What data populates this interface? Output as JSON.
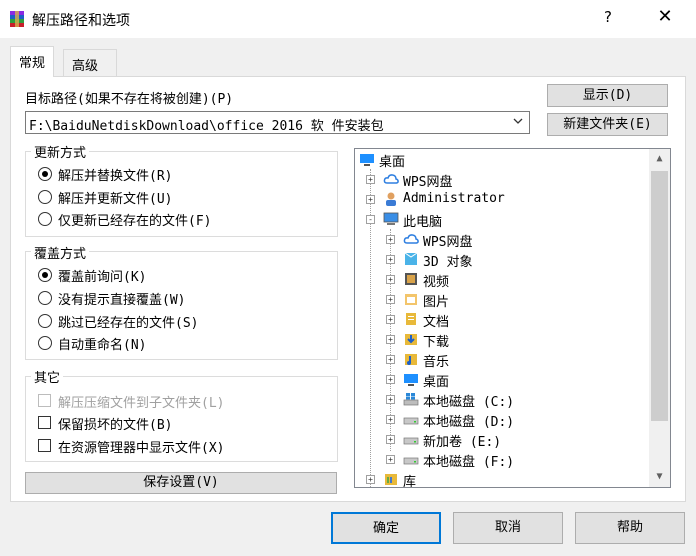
{
  "window": {
    "title": "解压路径和选项",
    "help": "?",
    "close": "✕"
  },
  "tabs": [
    {
      "label": "常规"
    },
    {
      "label": "高级"
    }
  ],
  "dest": {
    "label": "目标路径(如果不存在将被创建)(P)",
    "value": "F:\\BaiduNetdiskDownload\\office 2016 软 件安装包",
    "show_button": "显示(D)",
    "new_folder_button": "新建文件夹(E)"
  },
  "update_mode": {
    "title": "更新方式",
    "options": [
      "解压并替换文件(R)",
      "解压并更新文件(U)",
      "仅更新已经存在的文件(F)"
    ],
    "selected": 0
  },
  "overwrite_mode": {
    "title": "覆盖方式",
    "options": [
      "覆盖前询问(K)",
      "没有提示直接覆盖(W)",
      "跳过已经存在的文件(S)",
      "自动重命名(N)"
    ],
    "selected": 0
  },
  "misc": {
    "title": "其它",
    "options": [
      {
        "label": "解压压缩文件到子文件夹(L)",
        "checked": false,
        "disabled": true
      },
      {
        "label": "保留损坏的文件(B)",
        "checked": false,
        "disabled": false
      },
      {
        "label": "在资源管理器中显示文件(X)",
        "checked": false,
        "disabled": false
      }
    ]
  },
  "save_settings": "保存设置(V)",
  "tree": {
    "items": [
      {
        "label": "桌面",
        "level": 0,
        "expander": "",
        "icon": "desktop-icon"
      },
      {
        "label": "WPS网盘",
        "level": 1,
        "expander": "+",
        "icon": "cloud-icon"
      },
      {
        "label": "Administrator",
        "level": 1,
        "expander": "+",
        "icon": "user-icon"
      },
      {
        "label": "此电脑",
        "level": 1,
        "expander": "-",
        "icon": "computer-icon"
      },
      {
        "label": "WPS网盘",
        "level": 2,
        "expander": "+",
        "icon": "cloud-icon"
      },
      {
        "label": "3D 对象",
        "level": 2,
        "expander": "+",
        "icon": "3d-objects-icon"
      },
      {
        "label": "视频",
        "level": 2,
        "expander": "+",
        "icon": "video-icon"
      },
      {
        "label": "图片",
        "level": 2,
        "expander": "+",
        "icon": "pictures-icon"
      },
      {
        "label": "文档",
        "level": 2,
        "expander": "+",
        "icon": "documents-icon"
      },
      {
        "label": "下载",
        "level": 2,
        "expander": "+",
        "icon": "downloads-icon"
      },
      {
        "label": "音乐",
        "level": 2,
        "expander": "+",
        "icon": "music-icon"
      },
      {
        "label": "桌面",
        "level": 2,
        "expander": "+",
        "icon": "desktop-icon"
      },
      {
        "label": "本地磁盘 (C:)",
        "level": 2,
        "expander": "+",
        "icon": "windows-drive-icon"
      },
      {
        "label": "本地磁盘 (D:)",
        "level": 2,
        "expander": "+",
        "icon": "drive-icon"
      },
      {
        "label": "新加卷 (E:)",
        "level": 2,
        "expander": "+",
        "icon": "drive-icon"
      },
      {
        "label": "本地磁盘 (F:)",
        "level": 2,
        "expander": "+",
        "icon": "drive-icon"
      },
      {
        "label": "库",
        "level": 1,
        "expander": "+",
        "icon": "library-icon"
      }
    ]
  },
  "buttons": {
    "ok": "确定",
    "cancel": "取消",
    "help": "帮助"
  },
  "colors": {
    "selected_focus": "#0078d7",
    "folder": "#e8b93a",
    "desktop": "#1e90ff"
  }
}
